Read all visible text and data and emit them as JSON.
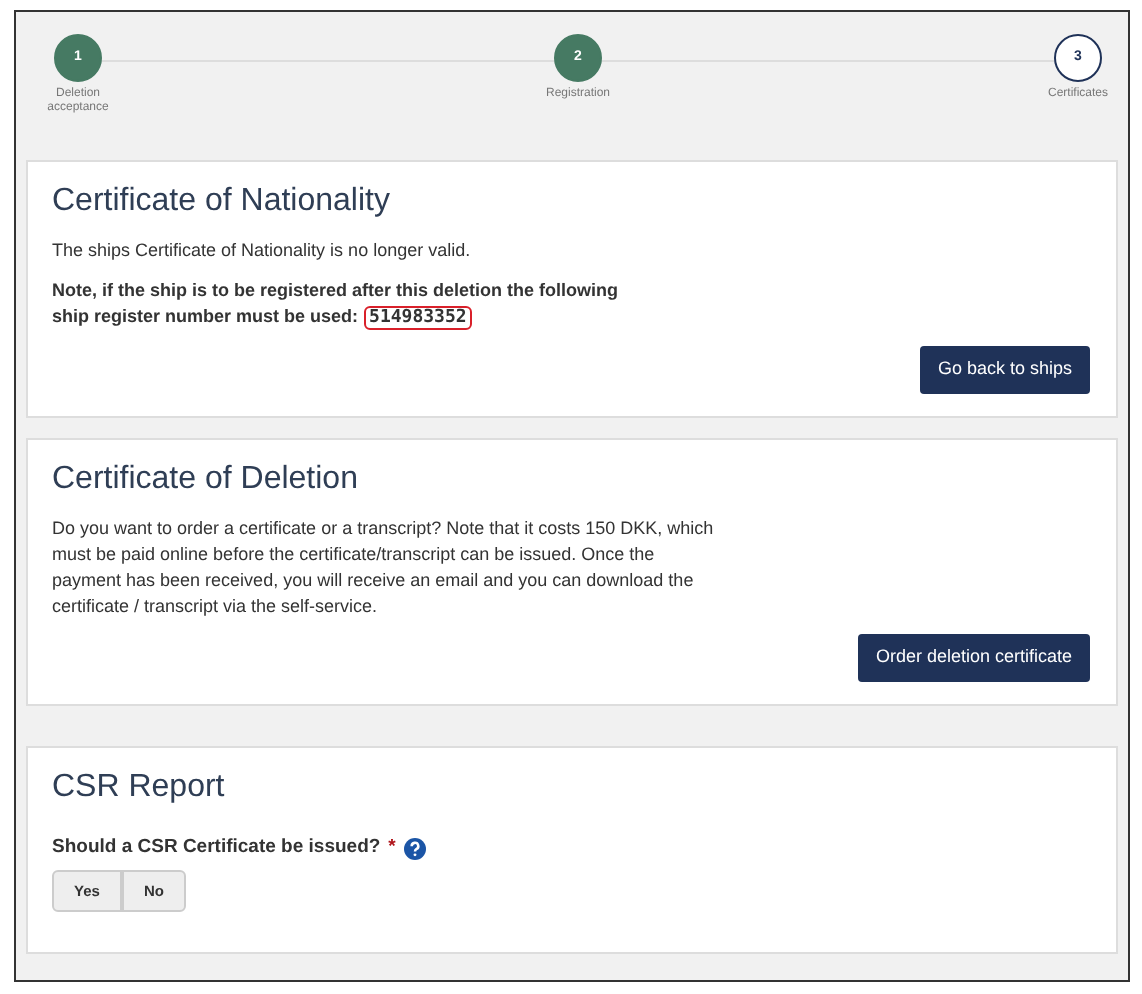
{
  "stepper": [
    {
      "number": "1",
      "label": "Deletion acceptance",
      "completed": true
    },
    {
      "number": "2",
      "label": "Registration",
      "completed": true
    },
    {
      "number": "3",
      "label": "Certificates",
      "completed": false
    }
  ],
  "nationality": {
    "title": "Certificate of Nationality",
    "text": "The ships Certificate of Nationality is no longer valid.",
    "note": "Note, if the ship is to be registered after this deletion the following ship register number must be used:",
    "register_number": "514983352",
    "button": "Go back to ships"
  },
  "deletion": {
    "title": "Certificate of Deletion",
    "text": "Do you want to order a certificate or a transcript? Note that it costs 150 DKK, which must be paid online before the certificate/transcript can be issued. Once the payment has been received, you will receive an email and you can download the certificate / transcript via the self-service.",
    "button": "Order deletion certificate"
  },
  "csr": {
    "title": "CSR Report",
    "question": "Should a CSR Certificate be issued?",
    "required_mark": "*",
    "options": [
      {
        "label": "Yes",
        "selected": false
      },
      {
        "label": "No",
        "selected": false
      }
    ]
  }
}
